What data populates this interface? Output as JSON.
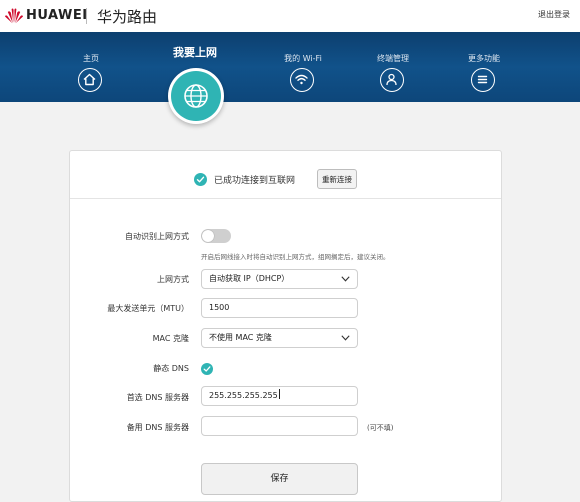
{
  "brand": {
    "name": "HUAWEI",
    "product": "华为路由"
  },
  "header": {
    "logout": "退出登录"
  },
  "nav": {
    "items": [
      {
        "label": "主页",
        "icon": "home-icon"
      },
      {
        "label": "我的 Wi-Fi",
        "icon": "wifi-icon"
      },
      {
        "label": "终端管理",
        "icon": "user-icon"
      },
      {
        "label": "更多功能",
        "icon": "menu-icon"
      }
    ],
    "active": {
      "label": "我要上网",
      "icon": "globe-icon"
    }
  },
  "status": {
    "text": "已成功连接到互联网",
    "reconnect": "重新连接"
  },
  "form": {
    "auto_detect": {
      "label": "自动识别上网方式",
      "enabled": false,
      "hint": "开启后网线接入时将自动识别上网方式，组网搁定后，建议关闭。"
    },
    "connection_type": {
      "label": "上网方式",
      "value": "自动获取 IP（DHCP）"
    },
    "mtu": {
      "label": "最大发送单元（MTU）",
      "value": "1500"
    },
    "mac_clone": {
      "label": "MAC 克隆",
      "value": "不使用 MAC 克隆"
    },
    "static_dns": {
      "label": "静态 DNS",
      "checked": true
    },
    "primary_dns": {
      "label": "首选 DNS 服务器",
      "value": "255.255.255.255"
    },
    "secondary_dns": {
      "label": "备用 DNS 服务器",
      "value": "",
      "optional": "(可不填)"
    },
    "save": "保存"
  },
  "colors": {
    "accent": "#2fb4b4",
    "nav_bg": "#11528a",
    "brand_red": "#cf0a2c"
  }
}
